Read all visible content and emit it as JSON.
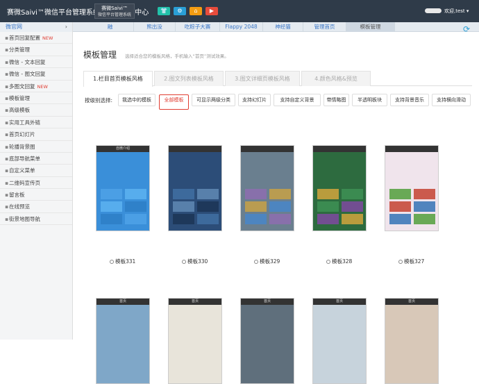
{
  "topbar": {
    "brand": "赛微Saivi™微信平台管理系统V",
    "brand_tail": "理中心",
    "logo": "赛微Saivi™",
    "logo_sub": "微信平台管理系统",
    "buttons": [
      {
        "icon": "shirt-icon",
        "color": "#22c1a9"
      },
      {
        "icon": "gear-icon",
        "color": "#2a9fd6"
      },
      {
        "icon": "home-icon",
        "color": "#f39c12"
      },
      {
        "icon": "play-icon",
        "color": "#e74c3c"
      }
    ],
    "user": "欢迎,test ▾"
  },
  "sidebar": {
    "header": "微官网",
    "items": [
      {
        "label": "首页回复配置",
        "new": "NEW"
      },
      {
        "label": "分类管理",
        "new": ""
      },
      {
        "label": "微信 - 文本回复",
        "new": ""
      },
      {
        "label": "微信 - 图文回复",
        "new": ""
      },
      {
        "label": "多图文回复",
        "new": "NEW"
      },
      {
        "label": "模板管理",
        "new": ""
      },
      {
        "label": "高级模板",
        "new": ""
      },
      {
        "label": "实用工具外链",
        "new": ""
      },
      {
        "label": "首页幻灯片",
        "new": ""
      },
      {
        "label": "轮播背景图",
        "new": ""
      },
      {
        "label": "底部导航菜单",
        "new": ""
      },
      {
        "label": "自定义菜单",
        "new": ""
      },
      {
        "label": "二维码宣传页",
        "new": ""
      },
      {
        "label": "留言板",
        "new": ""
      },
      {
        "label": "在线预览",
        "new": ""
      },
      {
        "label": "街景地图导航",
        "new": ""
      }
    ]
  },
  "tabs": [
    "融",
    "熊出没",
    "吃粽子大赛",
    "Flappy 2048",
    "神经猫",
    "管理首页",
    "模板管理"
  ],
  "main": {
    "title": "模板管理",
    "hint": "选择适合您的模板风格，手机输入“首页”测试效果。",
    "subtabs": [
      "1.栏目首页模板风格",
      "2.图文列表模板风格",
      "3.图文详细页模板风格",
      "4.颜色风格&预览"
    ],
    "filter_label": "按级别选择:",
    "filters": [
      "我选中的模板",
      "全部模板",
      "可显示两级分类",
      "支持幻灯片",
      "支持自定义背景",
      "带情略图",
      "半透明板块",
      "支持背景音乐",
      "支持横向滑动"
    ],
    "active_filter": 1,
    "templates": [
      {
        "name": "模板331",
        "bar": "自微介绍",
        "bg": "#3a8fd9"
      },
      {
        "name": "模板330",
        "bar": "",
        "bg": "#2c4d78"
      },
      {
        "name": "模板329",
        "bar": "",
        "bg": "#6a7f8f"
      },
      {
        "name": "模板328",
        "bar": "",
        "bg": "#2d6b3f"
      },
      {
        "name": "模板327",
        "bar": "",
        "bg": "#f0e4ec"
      }
    ],
    "bottom_bars": [
      "首页",
      "首页",
      "首页",
      "首页",
      "首页"
    ]
  }
}
